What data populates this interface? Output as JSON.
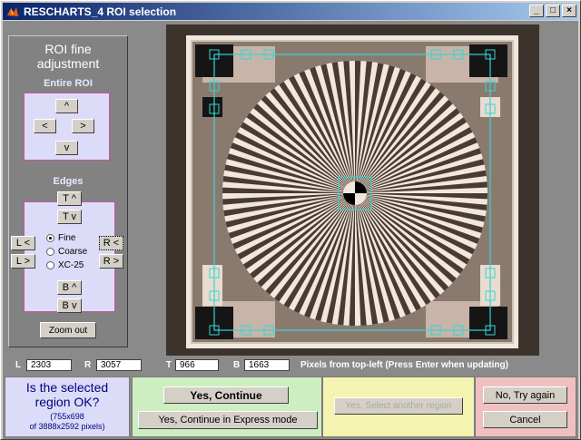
{
  "window": {
    "title": "RESCHARTS_4 ROI selection",
    "minimize_label": "_",
    "maximize_label": "□",
    "close_label": "×"
  },
  "left_panel": {
    "title_line1": "ROI fine",
    "title_line2": "adjustment",
    "entire_roi_label": "Entire ROI",
    "up_label": "^",
    "left_label": "<",
    "right_label": ">",
    "down_label": "v",
    "edges_label": "Edges",
    "t_up_label": "T ^",
    "t_down_label": "T v",
    "l_left_label": "L <",
    "l_right_label": "L >",
    "r_left_label": "R <",
    "r_right_label": "R >",
    "b_up_label": "B ^",
    "b_down_label": "B v",
    "radio_fine": "Fine",
    "radio_coarse": "Coarse",
    "radio_xc25": "XC-25",
    "zoom_out_label": "Zoom out"
  },
  "coords": {
    "l_label": "L",
    "l_value": "2303",
    "r_label": "R",
    "r_value": "3057",
    "t_label": "T",
    "t_value": "966",
    "b_label": "B",
    "b_value": "1663",
    "hint": "Pixels from top-left  (Press Enter when updating)"
  },
  "bottom": {
    "question_line1": "Is the selected",
    "question_line2": "region OK?",
    "size_line1": "(755x698",
    "size_line2": "of 3888x2592 pixels)",
    "yes_continue": "Yes, Continue",
    "yes_express": "Yes, Continue in Express mode",
    "yes_select_another": "Yes, Select another region",
    "no_try_again": "No, Try again",
    "cancel": "Cancel"
  },
  "colors": {
    "roi_line": "#33d6d6",
    "box_border": "#d050a8",
    "box_fill": "#dcdcf8",
    "panel_blue": "#dcdcf8",
    "panel_green": "#cceec0",
    "panel_yellow": "#f4f4b0",
    "panel_pink": "#f0c0c0"
  }
}
